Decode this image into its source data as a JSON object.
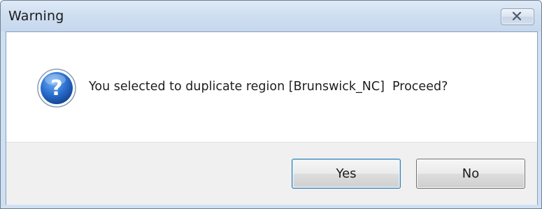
{
  "window": {
    "title": "Warning",
    "close_icon": "close-icon"
  },
  "dialog": {
    "icon": "question-icon",
    "message": "You selected to duplicate region [Brunswick_NC]  Proceed?"
  },
  "buttons": {
    "yes_label": "Yes",
    "no_label": "No"
  },
  "colors": {
    "titlebar": "#cfdff1",
    "icon_blue": "#1f5fb8",
    "default_button_border": "#3c7fb1"
  }
}
